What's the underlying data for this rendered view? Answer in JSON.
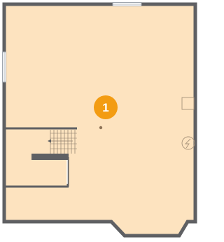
{
  "floor_plan": {
    "colors": {
      "floor_fill": "#fde3bf",
      "wall_stroke": "#5f6063",
      "window_stroke": "#a0a6ad",
      "window_fill": "#ffffff",
      "marker_fill": "#f39c12",
      "marker_text": "#ffffff",
      "fixture_stroke": "#a7937a",
      "stairs_stroke": "#8a7c6a",
      "step_bar": "#5f6063",
      "dot_fill": "#8d7357"
    },
    "rooms": [
      {
        "marker": {
          "label": "1"
        }
      }
    ],
    "icons": [
      "floor-drain-icon",
      "electrical-outlet-icon",
      "stairs-arrow-icon",
      "window-icon"
    ]
  }
}
